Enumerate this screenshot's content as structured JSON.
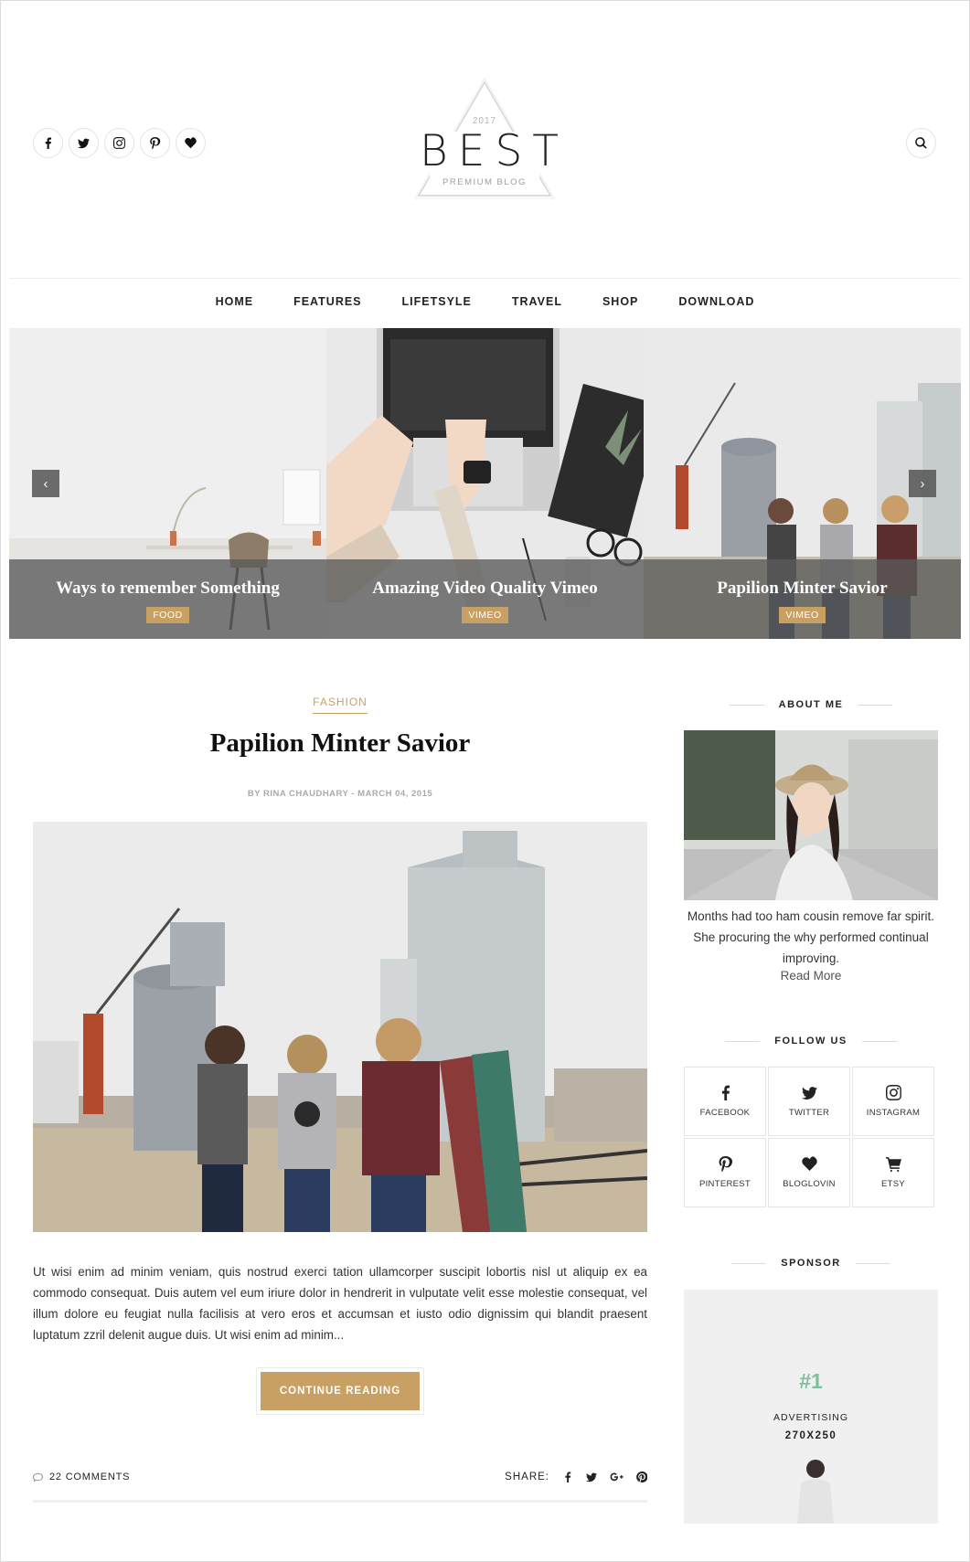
{
  "header": {
    "social_icons": [
      "facebook-icon",
      "twitter-icon",
      "instagram-icon",
      "pinterest-icon",
      "heart-icon"
    ],
    "search_icon": "search-icon",
    "logo": {
      "year": "2017",
      "title": "BEST",
      "subtitle": "PREMIUM BLOG"
    }
  },
  "nav": {
    "items": [
      "HOME",
      "FEATURES",
      "LIFETSYLE",
      "TRAVEL",
      "SHOP",
      "DOWNLOAD"
    ]
  },
  "slider": {
    "slides": [
      {
        "title": "Ways to remember Something",
        "tag": "FOOD"
      },
      {
        "title": "Amazing Video Quality Vimeo",
        "tag": "VIMEO"
      },
      {
        "title": "Papilion Minter Savior",
        "tag": "VIMEO"
      }
    ],
    "prev_icon": "chevron-left-icon",
    "next_icon": "chevron-right-icon"
  },
  "post": {
    "category": "FASHION",
    "title": "Papilion Minter Savior",
    "meta": "BY RINA CHAUDHARY - MARCH 04, 2015",
    "excerpt": "Ut wisi enim ad minim veniam, quis nostrud exerci tation ullamcorper suscipit lobortis nisl ut aliquip ex ea commodo consequat. Duis autem vel eum iriure dolor in hendrerit in vulputate velit esse molestie consequat, vel illum dolore eu feugiat nulla facilisis at vero eros et accumsan et iusto odio dignissim qui blandit praesent luptatum zzril delenit augue duis. Ut wisi enim ad minim...",
    "button": "CONTINUE READING",
    "comments": "22 COMMENTS",
    "share_label": "SHARE:"
  },
  "sidebar": {
    "about": {
      "title": "ABOUT ME",
      "text": "Months had too ham cousin remove far spirit. She procuring the why performed continual improving.",
      "read_more": "Read More"
    },
    "follow": {
      "title": "FOLLOW US",
      "items": [
        {
          "label": "FACEBOOK",
          "icon": "facebook-icon"
        },
        {
          "label": "TWITTER",
          "icon": "twitter-icon"
        },
        {
          "label": "INSTAGRAM",
          "icon": "instagram-icon"
        },
        {
          "label": "PINTEREST",
          "icon": "pinterest-icon"
        },
        {
          "label": "BLOGLOVIN",
          "icon": "heart-icon"
        },
        {
          "label": "ETSY",
          "icon": "cart-icon"
        }
      ]
    },
    "sponsor": {
      "title": "SPONSOR",
      "number": "#1",
      "label": "ADVERTISING",
      "size": "270X250"
    }
  },
  "colors": {
    "accent": "#c9a063",
    "sponsor_accent": "#7fbf9e",
    "caption_bg": "#5a5a5a"
  }
}
